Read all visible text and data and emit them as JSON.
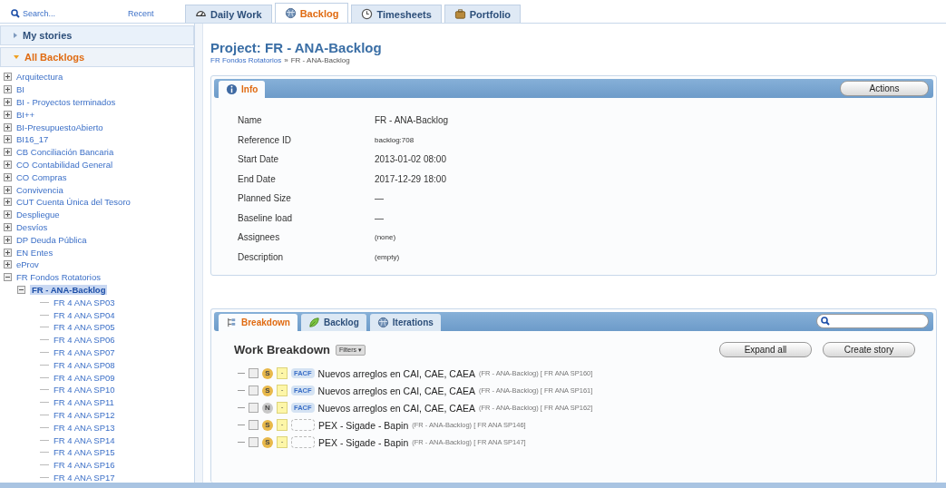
{
  "search": {
    "placeholder": "Search...",
    "recent_link": "Recent"
  },
  "main_tabs": [
    {
      "label": "Daily Work",
      "selected": false
    },
    {
      "label": "Backlog",
      "selected": true
    },
    {
      "label": "Timesheets",
      "selected": false
    },
    {
      "label": "Portfolio",
      "selected": false
    }
  ],
  "sidebar": {
    "sections": [
      {
        "label": "My stories",
        "expanded": false
      },
      {
        "label": "All Backlogs",
        "expanded": true
      }
    ],
    "tree": [
      {
        "label": "Arquitectura",
        "expanded": false,
        "selected": false
      },
      {
        "label": "BI",
        "expanded": false,
        "selected": false
      },
      {
        "label": "BI - Proyectos terminados",
        "expanded": false,
        "selected": false
      },
      {
        "label": "BI++",
        "expanded": false,
        "selected": false
      },
      {
        "label": "BI-PresupuestoAbierto",
        "expanded": false,
        "selected": false
      },
      {
        "label": "BI16_17",
        "expanded": false,
        "selected": false
      },
      {
        "label": "CB Conciliación Bancaria",
        "expanded": false,
        "selected": false
      },
      {
        "label": "CO Contabilidad General",
        "expanded": false,
        "selected": false
      },
      {
        "label": "CO Compras",
        "expanded": false,
        "selected": false
      },
      {
        "label": "Convivencia",
        "expanded": false,
        "selected": false
      },
      {
        "label": "CUT Cuenta Única del Tesoro",
        "expanded": false,
        "selected": false
      },
      {
        "label": "Despliegue",
        "expanded": false,
        "selected": false
      },
      {
        "label": "Desvíos",
        "expanded": false,
        "selected": false
      },
      {
        "label": "DP Deuda Pública",
        "expanded": false,
        "selected": false
      },
      {
        "label": "EN Entes",
        "expanded": false,
        "selected": false
      },
      {
        "label": "eProv",
        "expanded": false,
        "selected": false
      },
      {
        "label": "FR Fondos Rotatorios",
        "expanded": true,
        "selected": false,
        "children": [
          {
            "label": "FR - ANA-Backlog",
            "expanded": true,
            "selected": true,
            "children": [
              {
                "label": "FR 4 ANA SP03",
                "selected": false
              },
              {
                "label": "FR 4 ANA SP04",
                "selected": false
              },
              {
                "label": "FR 4 ANA SP05",
                "selected": false
              },
              {
                "label": "FR 4 ANA SP06",
                "selected": false
              },
              {
                "label": "FR 4 ANA SP07",
                "selected": false
              },
              {
                "label": "FR 4 ANA SP08",
                "selected": false
              },
              {
                "label": "FR 4 ANA SP09",
                "selected": false
              },
              {
                "label": "FR 4 ANA SP10",
                "selected": false
              },
              {
                "label": "FR 4 ANA SP11",
                "selected": false
              },
              {
                "label": "FR 4 ANA SP12",
                "selected": false
              },
              {
                "label": "FR 4 ANA SP13",
                "selected": false
              },
              {
                "label": "FR 4 ANA SP14",
                "selected": false
              },
              {
                "label": "FR 4 ANA SP15",
                "selected": false
              },
              {
                "label": "FR 4 ANA SP16",
                "selected": false
              },
              {
                "label": "FR 4 ANA SP17",
                "selected": false
              }
            ]
          }
        ]
      }
    ]
  },
  "page": {
    "title": "Project: FR - ANA-Backlog",
    "breadcrumb": [
      {
        "label": "FR Fondos Rotatorios",
        "kind": "link"
      },
      {
        "label": "»",
        "kind": "separator"
      },
      {
        "label": "FR - ANA-Backlog",
        "kind": "current"
      }
    ]
  },
  "info_panel": {
    "tab": {
      "label": "Info",
      "selected": true
    },
    "actions_button": "Actions",
    "fields": [
      {
        "label": "Name",
        "value": "FR - ANA-Backlog",
        "kind": "normal"
      },
      {
        "label": "Reference ID",
        "value": "backlog:708",
        "kind": "small"
      },
      {
        "label": "Start Date",
        "value": "2013-01-02 08:00",
        "kind": "normal"
      },
      {
        "label": "End Date",
        "value": "2017-12-29 18:00",
        "kind": "normal"
      },
      {
        "label": "Planned Size",
        "value": "—",
        "kind": "normal"
      },
      {
        "label": "Baseline load",
        "value": "—",
        "kind": "normal"
      },
      {
        "label": "Assignees",
        "value": "(none)",
        "kind": "small"
      },
      {
        "label": "Description",
        "value": "(empty)",
        "kind": "small"
      }
    ]
  },
  "breakdown_panel": {
    "tabs": [
      {
        "label": "Breakdown",
        "selected": true
      },
      {
        "label": "Backlog",
        "selected": false
      },
      {
        "label": "Iterations",
        "selected": false
      }
    ],
    "title": "Work Breakdown",
    "filters_button": "Filters ▾",
    "buttons": [
      "Expand all",
      "Create story"
    ],
    "stories": [
      {
        "checked": false,
        "state": "S",
        "color": "#e8b84a",
        "priority": "-",
        "label": "FACF",
        "name": "Nuevos arreglos en CAI, CAE, CAEA",
        "context": "(FR - ANA-Backlog) [ FR ANA SP160]"
      },
      {
        "checked": false,
        "state": "S",
        "color": "#e8b84a",
        "priority": "-",
        "label": "FACF",
        "name": "Nuevos arreglos en CAI, CAE, CAEA",
        "context": "(FR - ANA-Backlog) [ FR ANA SP161]"
      },
      {
        "checked": false,
        "state": "N",
        "color": "#c8c8c8",
        "priority": "-",
        "label": "FACF",
        "name": "Nuevos arreglos en CAI, CAE, CAEA",
        "context": "(FR - ANA-Backlog) [ FR ANA SP162]"
      },
      {
        "checked": false,
        "state": "S",
        "color": "#e8b84a",
        "priority": "-",
        "name": "PEX - Sigade - Bapin",
        "context": "(FR - ANA-Backlog) [ FR ANA SP146]"
      },
      {
        "checked": false,
        "state": "S",
        "color": "#e8b84a",
        "priority": "-",
        "name": "PEX - Sigade - Bapin",
        "context": "(FR - ANA-Backlog) [ FR ANA SP147]"
      }
    ]
  }
}
